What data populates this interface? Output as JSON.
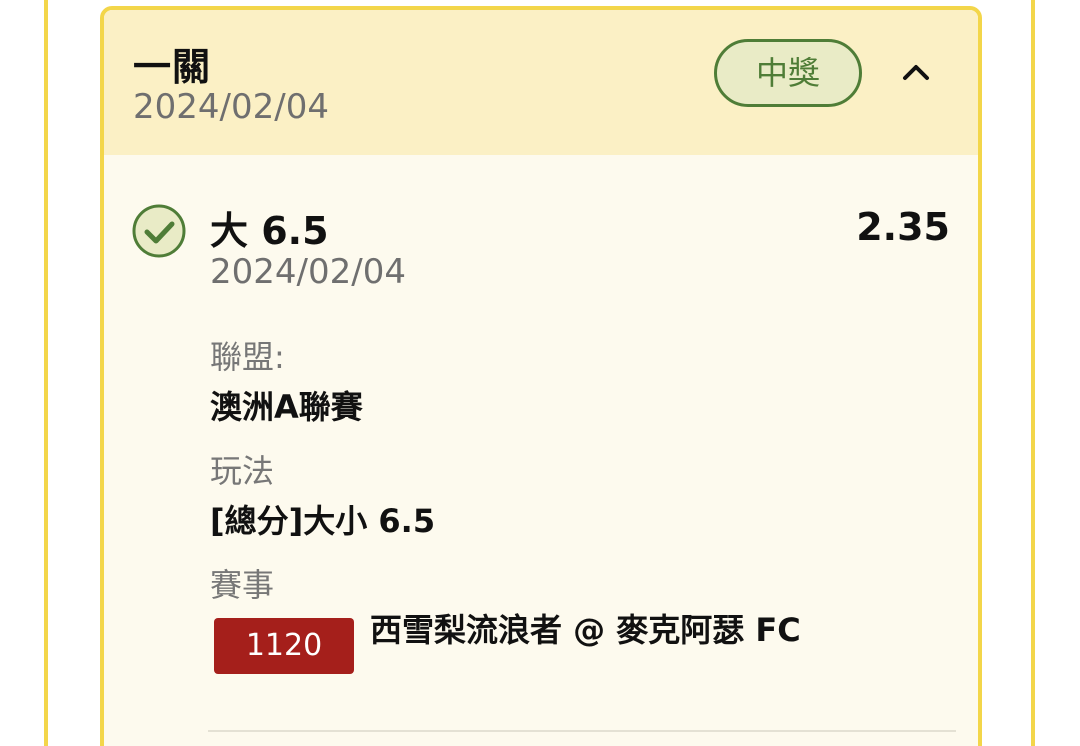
{
  "bet": {
    "type_label": "一關",
    "date": "2024/02/04",
    "status": "中獎",
    "colors": {
      "frame": "#f3d64a",
      "header_bg": "#fbf0c5",
      "body_bg": "#fdfaee",
      "status_green": "#4f7d37",
      "match_badge_red": "#a51f1b"
    },
    "icons": {
      "collapse": "chevron-up-icon",
      "status": "check-circle-icon"
    }
  },
  "selection": {
    "name": "大 6.5",
    "date": "2024/02/04",
    "odds": "2.35",
    "league_label": "聯盟:",
    "league_value": "澳洲A聯賽",
    "market_label": "玩法",
    "market_value": "[總分]大小 6.5",
    "event_label": "賽事",
    "match_number": "1120",
    "match_name": "西雪梨流浪者 @ 麥克阿瑟 FC"
  }
}
